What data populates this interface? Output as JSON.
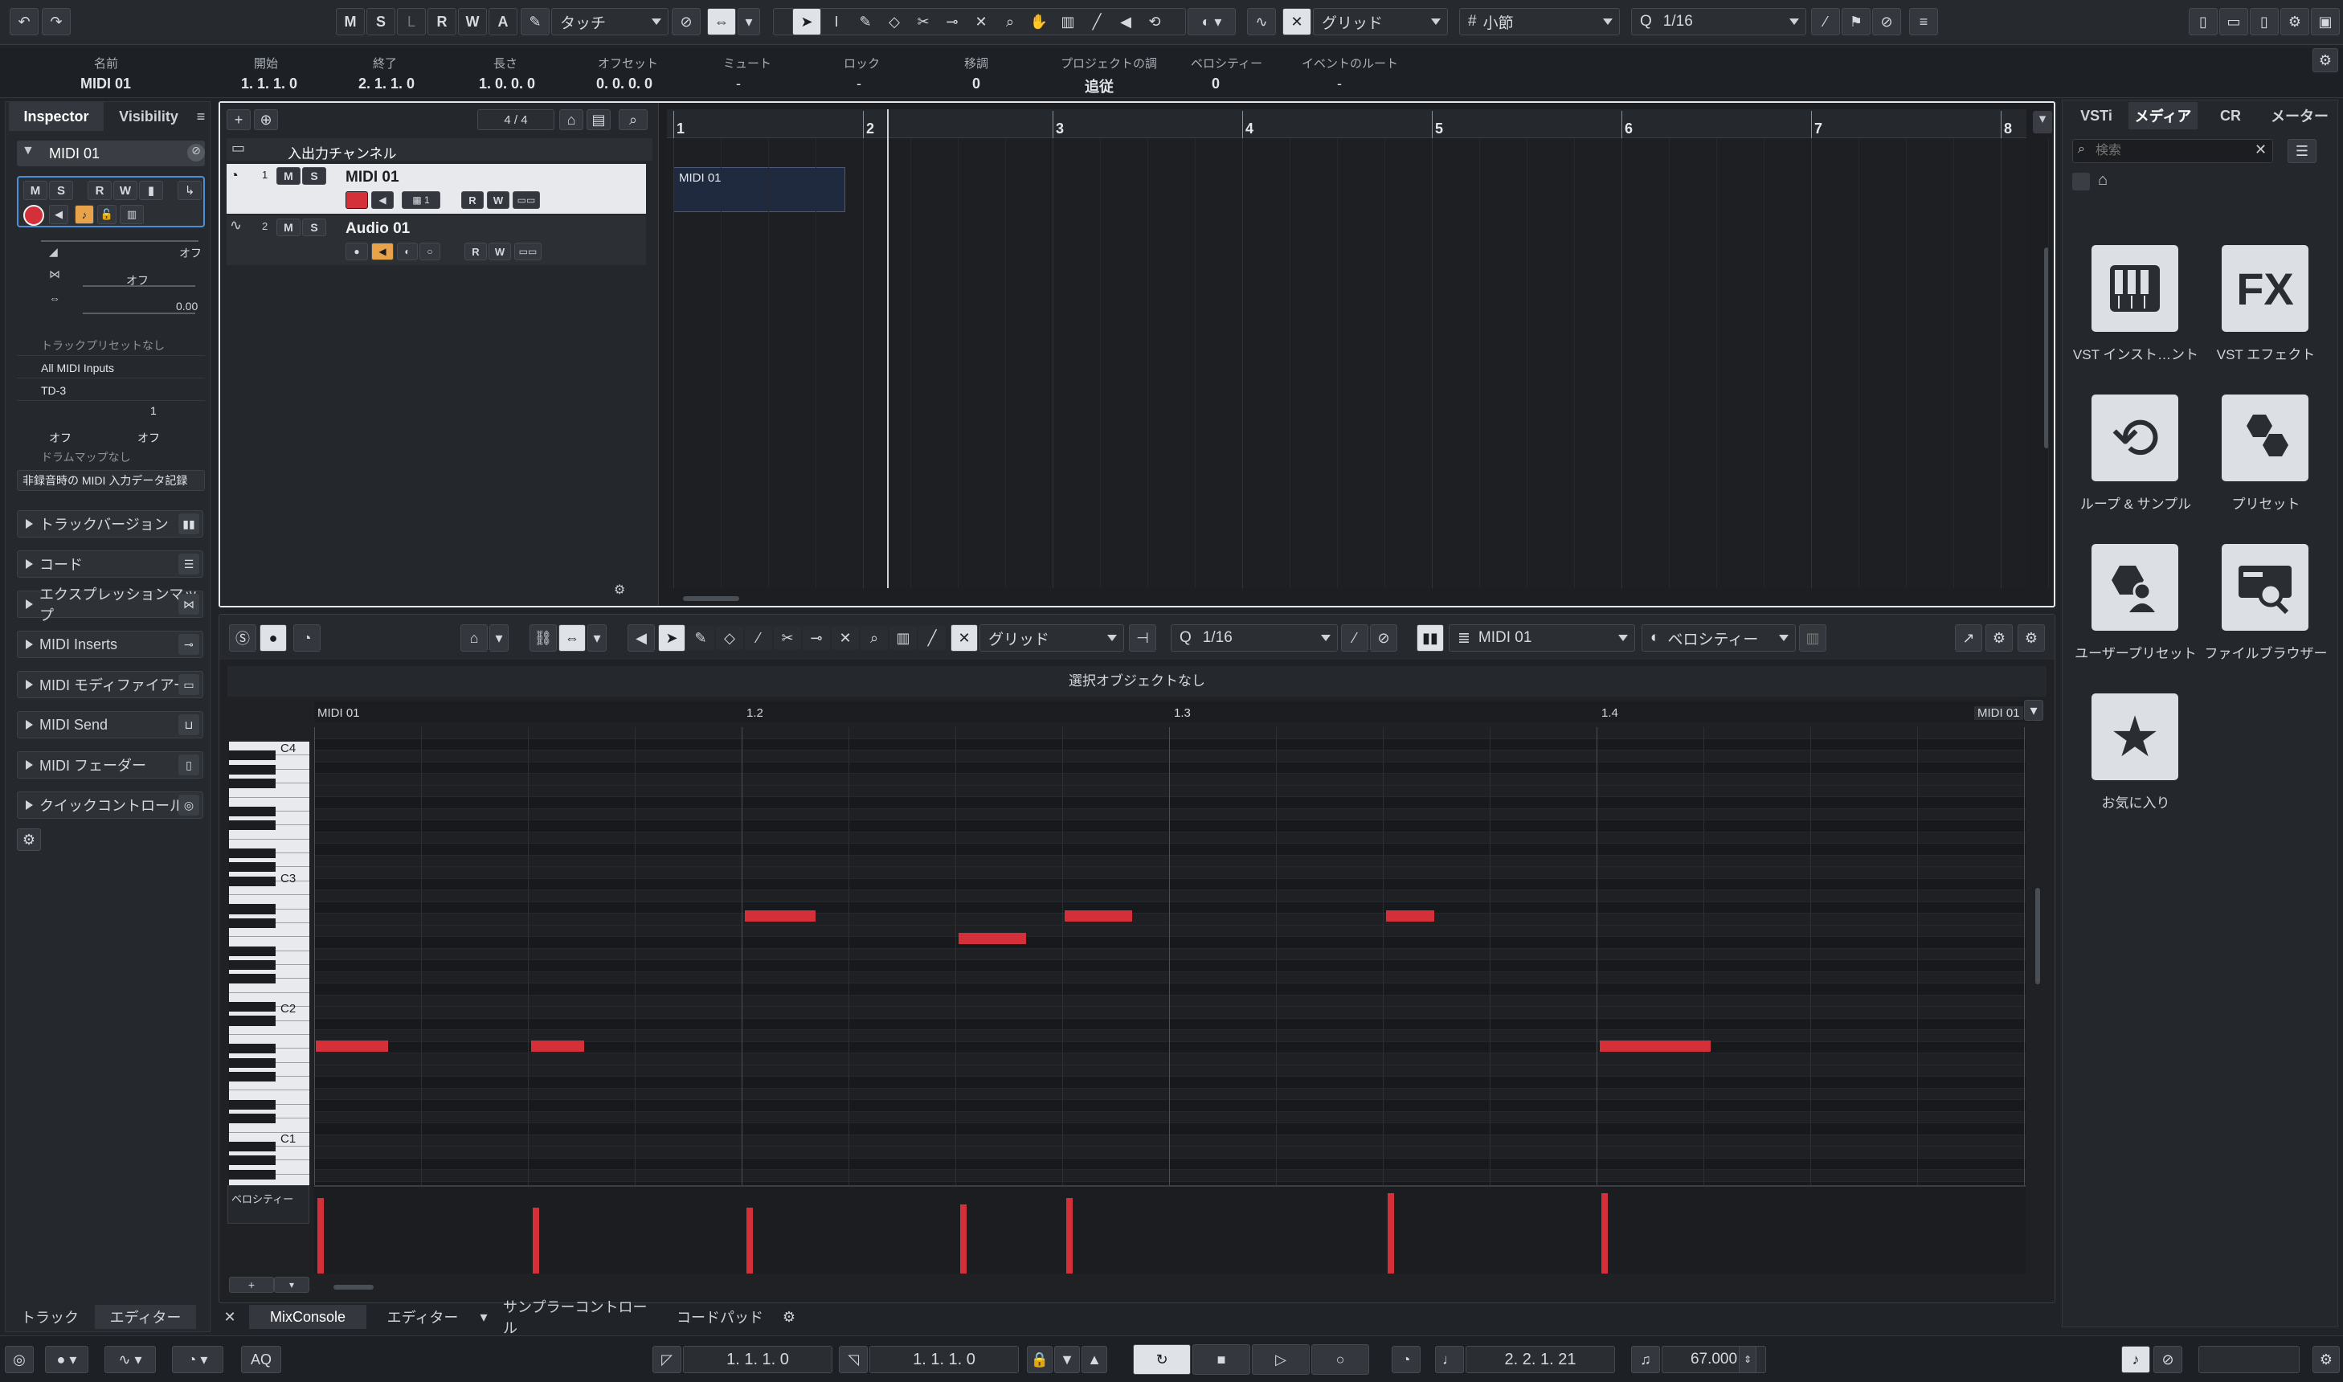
{
  "toolbar": {
    "mslrwa": [
      "M",
      "S",
      "L",
      "R",
      "W",
      "A"
    ],
    "automation_mode": "タッチ",
    "snap_type": "グリッド",
    "grid_type": "小節",
    "quantize": "1/16"
  },
  "infoline": {
    "fields": [
      {
        "label": "名前",
        "value": "MIDI 01"
      },
      {
        "label": "開始",
        "value": "1. 1. 1.   0"
      },
      {
        "label": "終了",
        "value": "2. 1. 1.   0"
      },
      {
        "label": "長さ",
        "value": "1. 0. 0.   0"
      },
      {
        "label": "オフセット",
        "value": "0. 0. 0.   0"
      },
      {
        "label": "ミュート",
        "value": "-"
      },
      {
        "label": "ロック",
        "value": "-"
      },
      {
        "label": "移調",
        "value": "0"
      },
      {
        "label": "プロジェクトの調",
        "value": "追従"
      },
      {
        "label": "ベロシティー",
        "value": "0"
      },
      {
        "label": "イベントのルート",
        "value": "-"
      }
    ]
  },
  "inspector": {
    "tabs": [
      "Inspector",
      "Visibility"
    ],
    "track_name": "MIDI 01",
    "volume_readout": "オフ",
    "pan_readout": "オフ",
    "delay_readout": "0.00",
    "preset": "トラックプリセットなし",
    "input": "All MIDI Inputs",
    "output": "TD-3",
    "channel": "1",
    "bank": "オフ",
    "program": "オフ",
    "drummap": "ドラムマップなし",
    "record_mode": "非録音時の MIDI 入力データ記録",
    "sections": [
      "トラックバージョン",
      "コード",
      "エクスプレッションマップ",
      "MIDI Inserts",
      "MIDI モディファイアー",
      "MIDI Send",
      "MIDI フェーダー",
      "クイックコントロール"
    ]
  },
  "tracklist": {
    "signature": "4 / 4",
    "folder": "入出力チャンネル",
    "tracks": [
      {
        "num": "1",
        "name": "MIDI 01"
      },
      {
        "num": "2",
        "name": "Audio 01"
      }
    ],
    "ruler": [
      "1",
      "2",
      "3",
      "4",
      "5",
      "6",
      "7",
      "8"
    ],
    "part_name": "MIDI 01"
  },
  "editor": {
    "snap": "グリッド",
    "quantize": "1/16",
    "track": "MIDI 01",
    "controller": "ベロシティー",
    "status": "選択オブジェクトなし",
    "ruler_start": "MIDI 01",
    "ruler_marks": [
      "1.2",
      "1.3",
      "1.4"
    ],
    "ruler_end": "MIDI 01",
    "octaves": [
      "C4",
      "C3",
      "C2",
      "C1"
    ],
    "lane_label": "ベロシティー"
  },
  "mediabay": {
    "tabs": [
      "VSTi",
      "メディア",
      "CR",
      "メーター"
    ],
    "search_placeholder": "検索",
    "tiles": [
      {
        "label": "VST インスト…ント",
        "icon": "piano-keys-icon"
      },
      {
        "label": "VST エフェクト",
        "icon": "fx-icon"
      },
      {
        "label": "ループ & サンプル",
        "icon": "loop-icon"
      },
      {
        "label": "プリセット",
        "icon": "hexagon-icon"
      },
      {
        "label": "ユーザープリセット",
        "icon": "user-preset-icon"
      },
      {
        "label": "ファイルブラウザー",
        "icon": "file-browser-icon"
      },
      {
        "label": "お気に入り",
        "icon": "star-icon"
      }
    ]
  },
  "lower_zone": {
    "left_tabs": [
      "トラック",
      "エディター"
    ],
    "tabs": [
      "MixConsole",
      "エディター",
      "サンプラーコントロール",
      "コードパッド"
    ]
  },
  "transport": {
    "aq": "AQ",
    "left_locator": "1. 1. 1.   0",
    "right_locator": "1. 1. 1.   0",
    "position": "2. 2. 1. 21",
    "tempo": "67.000"
  },
  "colors": {
    "accent": "#d4303a",
    "selection": "#e8a34a",
    "background": "#202327"
  }
}
